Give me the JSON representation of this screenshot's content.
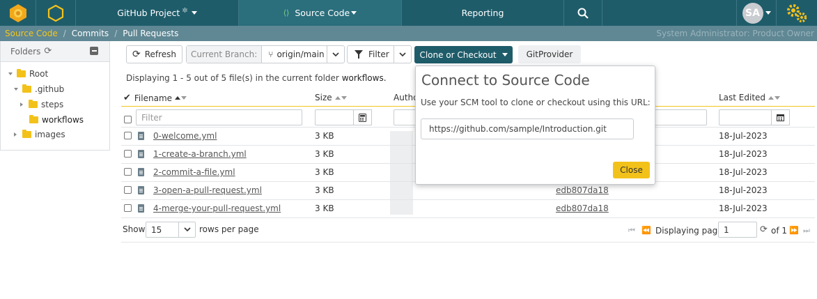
{
  "topbar": {
    "project": "GitHub Project",
    "source_code": "Source Code",
    "reporting": "Reporting",
    "avatar_initials": "SA"
  },
  "breadcrumbs": {
    "items": [
      "Source Code",
      "Commits",
      "Pull Requests"
    ],
    "role": "System Administrator: Product Owner"
  },
  "folders": {
    "title": "Folders",
    "tree": [
      "Root",
      ".github",
      "steps",
      "workflows",
      "images"
    ]
  },
  "toolbar": {
    "refresh": "Refresh",
    "branch_label": "Current Branch:",
    "branch_value": "origin/main",
    "filter": "Filter",
    "clone": "Clone or Checkout",
    "git_provider": "GitProvider"
  },
  "table": {
    "info_prefix": "Displaying 1 - 5 out of 5 file(s) in the current folder",
    "info_folder": "workflows.",
    "headers": {
      "filename": "Filename",
      "size": "Size",
      "author": "Autho",
      "last_edited": "Last Edited"
    },
    "filter_placeholder": "Filter",
    "rows": [
      {
        "name": "0-welcome.yml",
        "size": "3 KB",
        "commit": "",
        "date": "18-Jul-2023"
      },
      {
        "name": "1-create-a-branch.yml",
        "size": "3 KB",
        "commit": "",
        "date": "18-Jul-2023"
      },
      {
        "name": "2-commit-a-file.yml",
        "size": "3 KB",
        "commit": "",
        "date": "18-Jul-2023"
      },
      {
        "name": "3-open-a-pull-request.yml",
        "size": "3 KB",
        "commit": "edb807da18",
        "date": "18-Jul-2023"
      },
      {
        "name": "4-merge-your-pull-request.yml",
        "size": "3 KB",
        "commit": "edb807da18",
        "date": "18-Jul-2023"
      }
    ]
  },
  "pager": {
    "show": "Show",
    "page_size": "15",
    "rows_per_page": "rows per page",
    "displaying_page": "Displaying page",
    "page": "1",
    "of": "of 1"
  },
  "popup": {
    "title": "Connect to Source Code",
    "text": "Use your SCM tool to clone or checkout using this URL:",
    "url": "https://github.com/sample/Introduction.git",
    "close": "Close"
  },
  "colors": {
    "brand": "#1f5c6a",
    "accent": "#f3c21a"
  }
}
